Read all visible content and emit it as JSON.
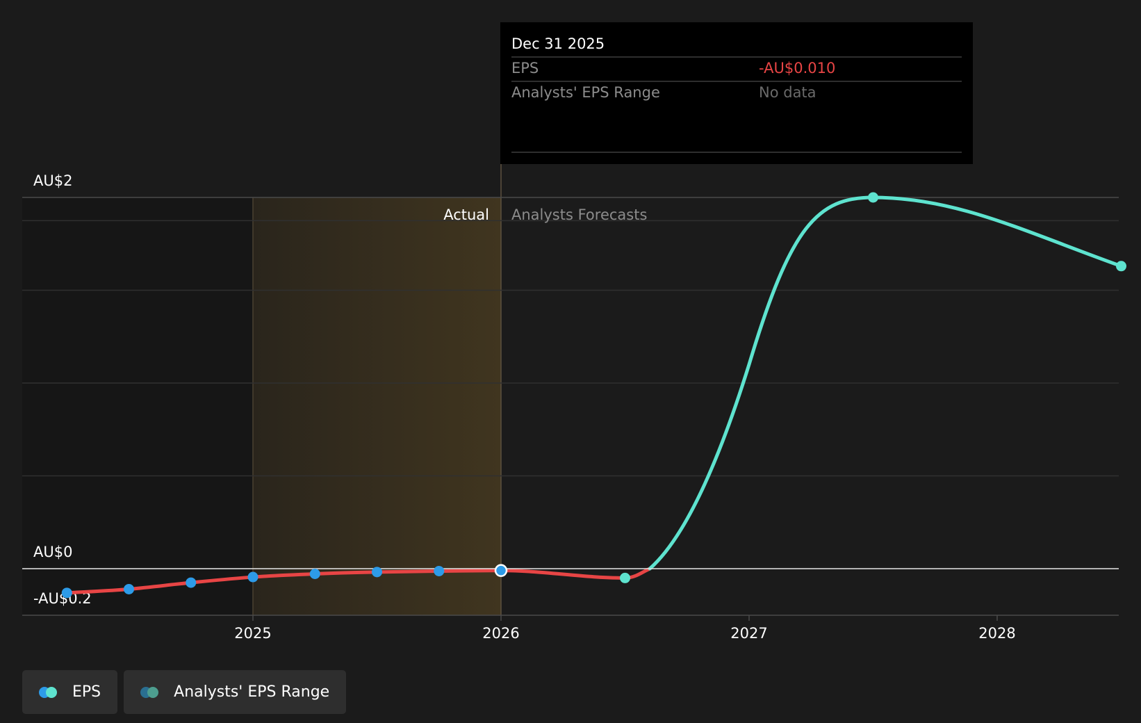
{
  "chart_data": {
    "type": "line",
    "x_ticks": [
      "2025",
      "2026",
      "2027",
      "2028"
    ],
    "y_ticks": [
      {
        "value": 2,
        "label": "AU$2"
      },
      {
        "value": 0,
        "label": "AU$0"
      },
      {
        "value": -0.25,
        "label": "-AU$0.2"
      }
    ],
    "xlim": [
      2024.07,
      2028.5
    ],
    "ylim": [
      -0.25,
      2.0
    ],
    "grid": true,
    "actual_label": "Actual",
    "forecast_label": "Analysts Forecasts",
    "series": [
      {
        "name": "EPS",
        "role": "actual",
        "color": "#e84545",
        "marker_color": "#2d9be8",
        "points": [
          {
            "x": 2024.25,
            "y": -0.13
          },
          {
            "x": 2024.5,
            "y": -0.11
          },
          {
            "x": 2024.75,
            "y": -0.075
          },
          {
            "x": 2025.0,
            "y": -0.045
          },
          {
            "x": 2025.25,
            "y": -0.028
          },
          {
            "x": 2025.5,
            "y": -0.018
          },
          {
            "x": 2025.75,
            "y": -0.013
          },
          {
            "x": 2026.0,
            "y": -0.01
          }
        ]
      },
      {
        "name": "EPS",
        "role": "forecast",
        "color": "#5ee3cf",
        "marker_color": "#5ee3cf",
        "points": [
          {
            "x": 2026.0,
            "y": -0.01
          },
          {
            "x": 2026.5,
            "y": -0.05
          },
          {
            "x": 2027.5,
            "y": 2.0
          },
          {
            "x": 2028.5,
            "y": 1.63
          }
        ]
      }
    ],
    "tooltip": {
      "date": "Dec 31 2025",
      "rows": [
        {
          "label": "EPS",
          "value": "-AU$0.010",
          "value_color": "#e84545"
        },
        {
          "label": "Analysts' EPS Range",
          "value": "No data",
          "value_color": "#6a6a6a"
        }
      ]
    }
  },
  "legend": [
    {
      "label": "EPS",
      "colors": [
        "#2d9be8",
        "#5ee3cf"
      ]
    },
    {
      "label": "Analysts' EPS Range",
      "colors": [
        "#2a6f91",
        "#4d9e8f"
      ]
    }
  ]
}
